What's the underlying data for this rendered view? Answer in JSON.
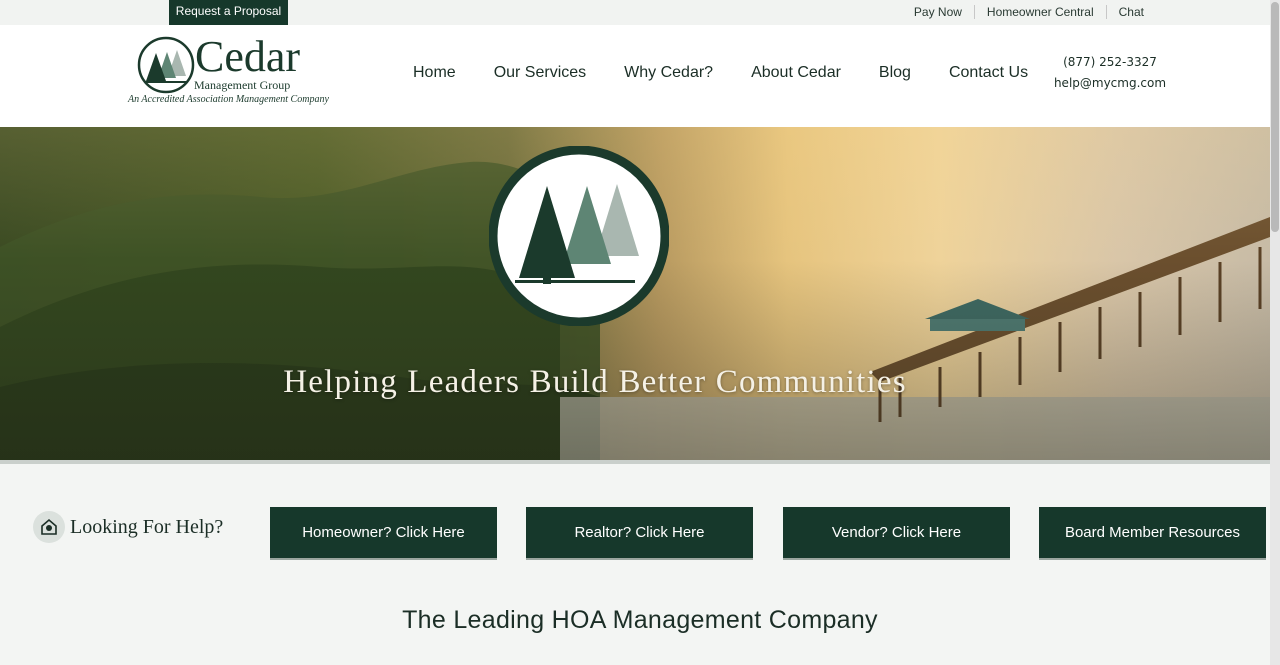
{
  "utility": {
    "proposal": "Request a Proposal",
    "links": [
      "Pay Now",
      "Homeowner Central",
      "Chat"
    ]
  },
  "logo": {
    "word": "Cedar",
    "sub": "Management Group",
    "tag": "An Accredited Association Management Company"
  },
  "nav": [
    "Home",
    "Our Services",
    "Why Cedar?",
    "About Cedar",
    "Blog",
    "Contact Us"
  ],
  "contact": {
    "phone": "(877) 252-3327",
    "email": "help@mycmg.com"
  },
  "hero": {
    "title": "Helping Leaders Build Better Communities"
  },
  "help": {
    "label": "Looking For Help?",
    "buttons": [
      "Homeowner? Click Here",
      "Realtor? Click Here",
      "Vendor? Click Here",
      "Board Member Resources"
    ]
  },
  "tagline": "The Leading HOA Management Company",
  "colors": {
    "brand": "#16382b",
    "tree_dark": "#1b3a2c",
    "tree_mid": "#5e8574",
    "tree_light": "#a9b7b0"
  },
  "icons": [
    "tree-logo-icon",
    "help-eye-icon"
  ]
}
